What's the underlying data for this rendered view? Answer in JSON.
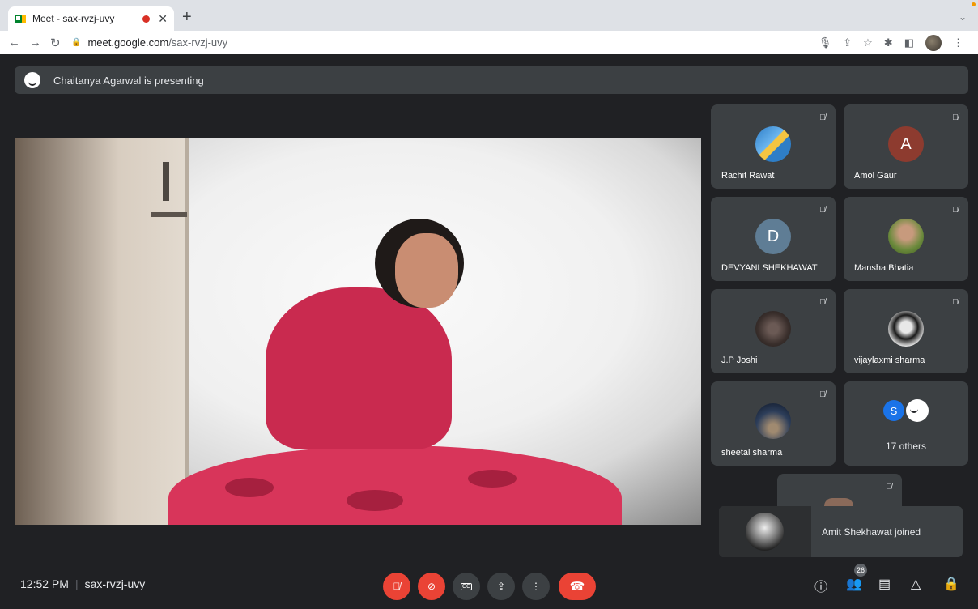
{
  "browser": {
    "tab_title": "Meet - sax-rvzj-uvy",
    "new_tab_icon": "plus-icon",
    "url_domain": "meet.google.com",
    "url_path": "/sax-rvzj-uvy"
  },
  "banner": {
    "text": "Chaitanya Agarwal is presenting"
  },
  "participants": [
    {
      "name": "Rachit Rawat",
      "initial": ""
    },
    {
      "name": "Amol Gaur",
      "initial": "A",
      "color": "#8d3b2f"
    },
    {
      "name": "DEVYANI SHEKHAWAT",
      "initial": "D",
      "color": "#5f7d95"
    },
    {
      "name": "Mansha Bhatia",
      "initial": ""
    },
    {
      "name": "J.P Joshi",
      "initial": ""
    },
    {
      "name": "vijaylaxmi sharma",
      "initial": ""
    },
    {
      "name": "sheetal sharma",
      "initial": ""
    }
  ],
  "others": {
    "label": "17 others",
    "initial": "S",
    "color": "#1a73e8"
  },
  "toast": {
    "text": "Amit Shekhawat joined"
  },
  "bottom": {
    "time": "12:52 PM",
    "separator": "|",
    "meeting_code": "sax-rvzj-uvy",
    "people_count": "26"
  }
}
